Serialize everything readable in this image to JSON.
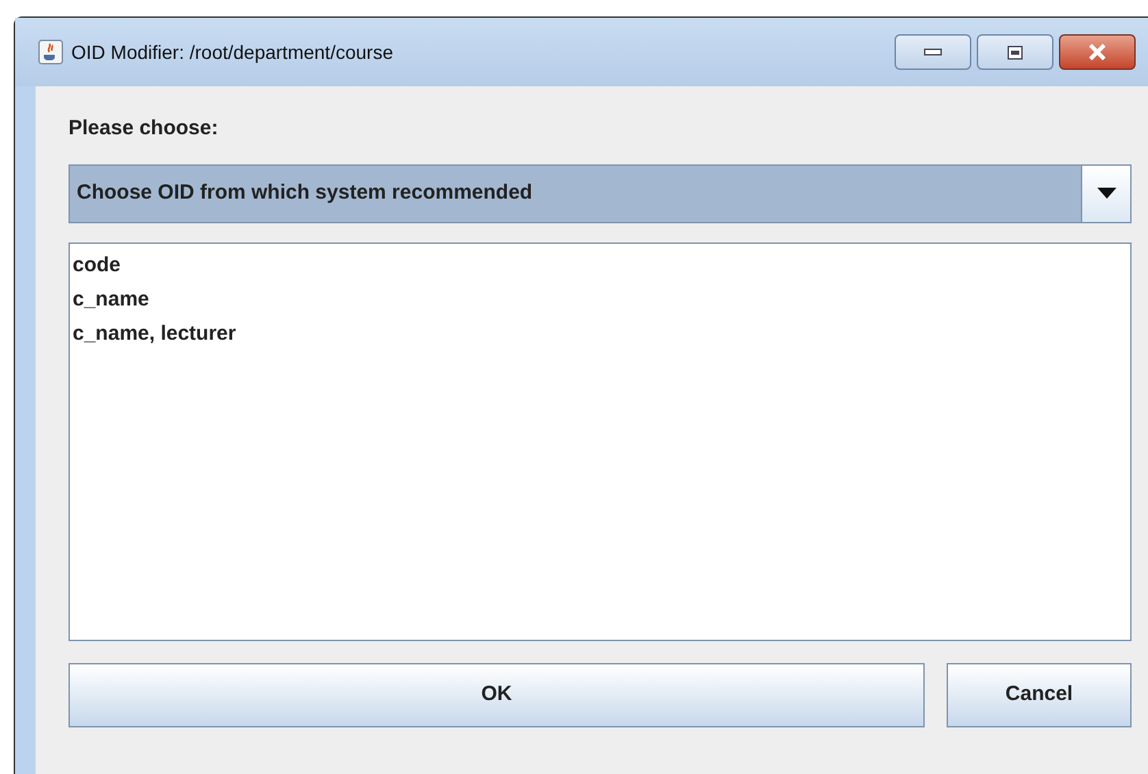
{
  "window": {
    "title": "OID Modifier: /root/department/course"
  },
  "prompt": "Please choose:",
  "dropdown": {
    "value": "Choose OID from which system recommended"
  },
  "list": {
    "items": [
      {
        "label": "code"
      },
      {
        "label": "c_name"
      },
      {
        "label": "c_name, lecturer"
      }
    ]
  },
  "buttons": [
    "OK",
    "Cancel"
  ]
}
